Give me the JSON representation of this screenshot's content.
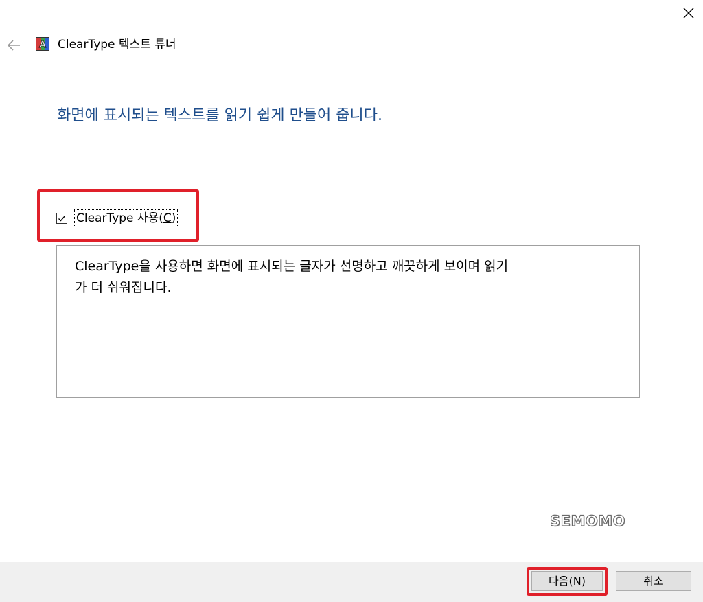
{
  "window": {
    "title": "ClearType 텍스트 튜너",
    "app_icon_letter": "A",
    "icon_names": {
      "close": "close-icon",
      "back": "back-arrow-icon",
      "app": "cleartype-app-icon"
    }
  },
  "main": {
    "heading": "화면에 표시되는 텍스트를 읽기 쉽게 만들어 줍니다.",
    "checkbox": {
      "label": "ClearType 사용(",
      "mnemonic": "C",
      "label_end": ")",
      "checked": true
    },
    "description": "ClearType을 사용하면 화면에 표시되는 글자가 선명하고 깨끗하게 보이며 읽기\n가 더 쉬워집니다."
  },
  "footer": {
    "next_label": "다음(",
    "next_mnemonic": "N",
    "next_end": ")",
    "cancel_label": "취소"
  },
  "watermark": "SEMOMO",
  "colors": {
    "heading": "#1f4e8c",
    "highlight": "#e0202a",
    "footer_bg": "#f0f0f0",
    "button_bg": "#e1e1e1"
  }
}
